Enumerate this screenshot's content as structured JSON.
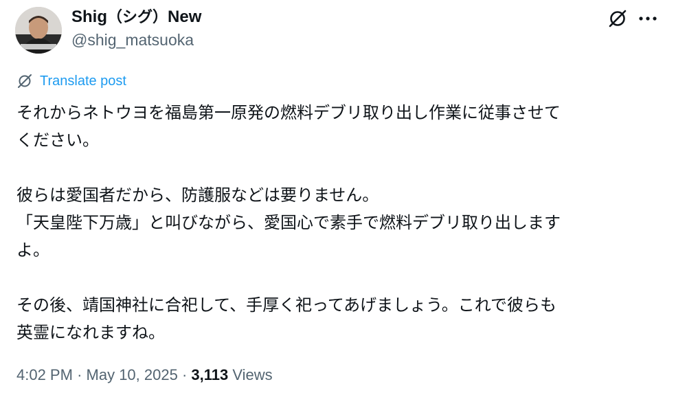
{
  "author": {
    "display_name": "Shig",
    "display_name_jp": "（シグ）",
    "display_name_suffix": "New",
    "handle": "@shig_matsuoka",
    "avatar_icon": "person-avatar"
  },
  "header": {
    "grok_icon": "grok-slash-icon",
    "more_icon": "ellipsis-icon"
  },
  "translate": {
    "label": "Translate post",
    "icon": "grok-translate-icon",
    "color": "#1d9bf0"
  },
  "post": {
    "lines": [
      "それからネトウヨを福島第一原発の燃料デブリ取り出し作業に従事させて",
      "ください。",
      "",
      "彼らは愛国者だから、防護服などは要りません。",
      "「天皇陛下万歳」と叫びながら、愛国心で素手で燃料デブリ取り出します",
      "よ。",
      "",
      "その後、靖国神社に合祀して、手厚く祀ってあげましょう。これで彼らも",
      "英霊になれますね。"
    ]
  },
  "meta": {
    "time": "4:02 PM",
    "separator": "·",
    "date": "May 10, 2025",
    "views_count": "3,113",
    "views_label": "Views"
  },
  "colors": {
    "text": "#0f1419",
    "secondary": "#536471",
    "accent": "#1d9bf0",
    "background": "#ffffff"
  }
}
